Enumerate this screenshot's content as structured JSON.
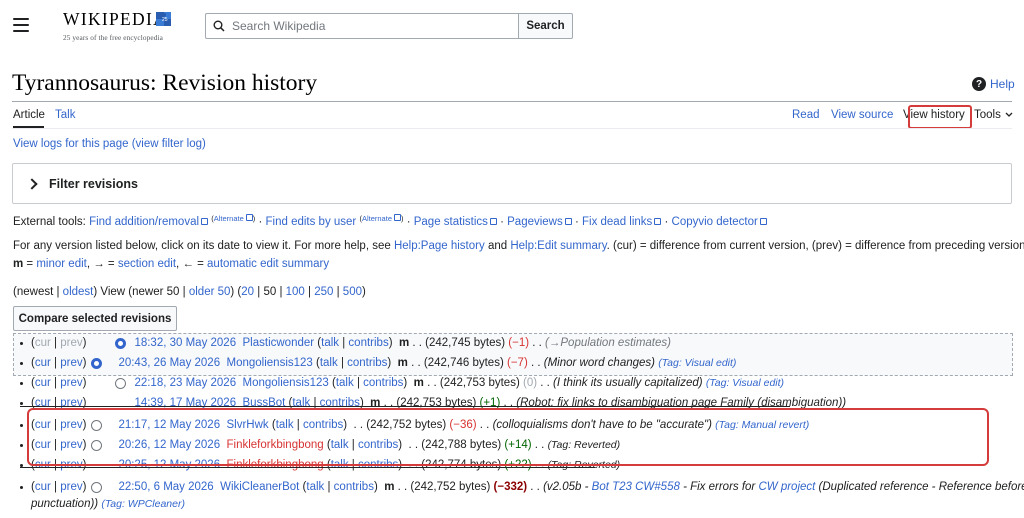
{
  "header": {
    "logo_word": "WIKIPEDIA",
    "logo_tagline": "25 years of the free encyclopedia",
    "search_placeholder": "Search Wikipedia",
    "search_button": "Search"
  },
  "page": {
    "title": "Tyrannosaurus: Revision history",
    "help": "Help"
  },
  "tabs": {
    "article": "Article",
    "talk": "Talk",
    "read": "Read",
    "view_source": "View source",
    "view_history": "View history",
    "tools": "Tools"
  },
  "logs_link": "View logs for this page",
  "filter_log_link": "(view filter log)",
  "filter_label": "Filter revisions",
  "external_tools": {
    "label": "External tools:",
    "items": [
      "Find addition/removal",
      "Find edits by user",
      "Page statistics",
      "Pageviews",
      "Fix dead links",
      "Copyvio detector"
    ],
    "alternate": "Alternate"
  },
  "help_text": {
    "line1_a": "For any version listed below, click on its date to view it. For more help, see",
    "page_history": "Help:Page history",
    "and": "and",
    "edit_summary": "Help:Edit summary",
    "line1_b": ". (cur) = difference from current version, (prev) = difference from preceding version,",
    "m": "m",
    "minor_edit": "minor edit",
    "arrow_right": "→",
    "section_edit": "section edit",
    "arrow_left": "←",
    "auto_summary": "automatic edit summary"
  },
  "nav": {
    "newest": "newest",
    "oldest": "oldest",
    "view": "View (newer 50",
    "older": "older 50",
    "counts": [
      "20",
      "50",
      "100",
      "250",
      "500"
    ]
  },
  "compare_button": "Compare selected revisions",
  "revisions": [
    {
      "date": "18:32, 30 May 2026",
      "user": "Plasticwonder",
      "minor": "m",
      "bytes": "(242,745 bytes)",
      "diff": "(−1)",
      "summary": "(→Population estimates)",
      "tag": ""
    },
    {
      "date": "20:43, 26 May 2026",
      "user": "Mongoliensis123",
      "minor": "m",
      "bytes": "(242,746 bytes)",
      "diff": "(−7)",
      "summary": "(Minor word changes)",
      "tag": "(Tag: Visual edit)"
    },
    {
      "date": "22:18, 23 May 2026",
      "user": "Mongoliensis123",
      "minor": "m",
      "bytes": "(242,753 bytes)",
      "diff": "(0)",
      "summary": "(I think its usually capitalized)",
      "tag": "(Tag: Visual edit)"
    },
    {
      "date": "14:39, 17 May 2026",
      "user": "BussBot",
      "minor": "m",
      "bytes": "(242,753 bytes)",
      "diff": "(+1)",
      "summary": "(Robot: fix links to disambiguation page Family (disambiguation))",
      "tag": ""
    },
    {
      "date": "21:17, 12 May 2026",
      "user": "SlvrHwk",
      "minor": "",
      "bytes": "(242,752 bytes)",
      "diff": "(−36)",
      "summary": "(colloquialisms don't have to be \"accurate\")",
      "tag": "(Tag: Manual revert)"
    },
    {
      "date": "20:26, 12 May 2026",
      "user": "Finkleforkbingbong",
      "minor": "",
      "bytes": "(242,788 bytes)",
      "diff": "(+14)",
      "summary": "",
      "tag": "(Tag: Reverted)"
    },
    {
      "date": "20:25, 12 May 2026",
      "user": "Finkleforkbingbong",
      "minor": "",
      "bytes": "(242,774 bytes)",
      "diff": "(+22)",
      "summary": "",
      "tag": "(Tag: Reverted)"
    },
    {
      "date": "22:50, 6 May 2026",
      "user": "WikiCleanerBot",
      "minor": "m",
      "bytes": "(242,752 bytes)",
      "diff": "(−332)",
      "summary_pre": "(v2.05b - ",
      "summary_link1": "Bot T23 CW#558",
      "summary_mid": " - Fix errors for ",
      "summary_link2": "CW project",
      "summary_post": " (Duplicated reference - Reference before",
      "summary_cont": "punctuation))",
      "tag": "(Tag: WPCleaner)"
    }
  ],
  "row_links": {
    "cur": "cur",
    "prev": "prev",
    "talk": "talk",
    "contribs": "contribs"
  }
}
